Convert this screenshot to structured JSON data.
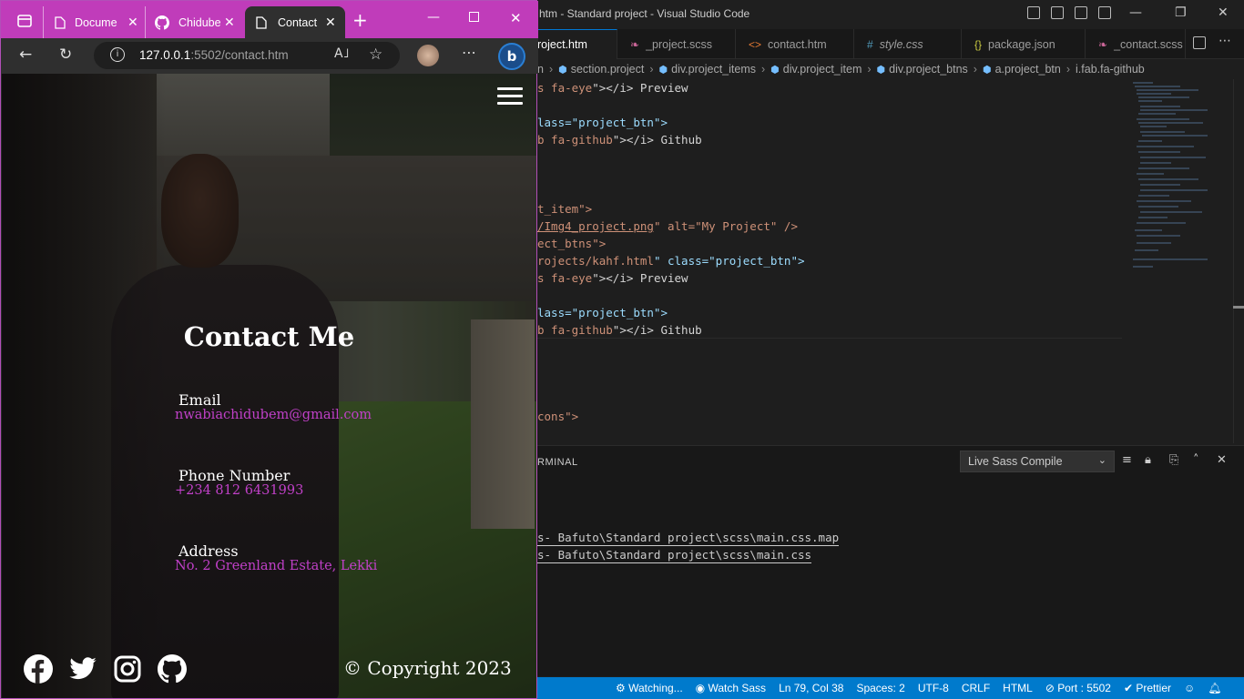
{
  "vscode": {
    "window_title": "htm - Standard project - Visual Studio Code",
    "tabs": [
      {
        "label": "roject.htm",
        "icon": "html-file-icon"
      },
      {
        "label": "_project.scss",
        "icon": "sass-file-icon"
      },
      {
        "label": "contact.htm",
        "icon": "html-file-icon"
      },
      {
        "label": "style.css",
        "icon": "css-file-icon"
      },
      {
        "label": "package.json",
        "icon": "json-file-icon"
      },
      {
        "label": "_contact.scss",
        "icon": "sass-file-icon"
      }
    ],
    "breadcrumb": [
      "n",
      "section.project",
      "div.project_items",
      "div.project_item",
      "div.project_btns",
      "a.project_btn",
      "i.fab.fa-github"
    ],
    "code_lines": [
      {
        "a": "s fa-eye",
        "b": "\"></i> Preview"
      },
      {
        "a": "lass=\"project_btn\">",
        "b": ""
      },
      {
        "a": "b fa-github",
        "b": "\"></i> Github"
      },
      {
        "a": "t_item\">",
        "b": ""
      },
      {
        "a": "/Img4_project.png",
        "b": "\" alt=\"My Project\" />"
      },
      {
        "a": "ect_btns\">",
        "b": ""
      },
      {
        "a": "rojects/kahf.html",
        "b": "\" class=\"project_btn\">"
      },
      {
        "a": "s fa-eye",
        "b": "\"></i> Preview"
      },
      {
        "a": "lass=\"project_btn\">",
        "b": ""
      },
      {
        "a": "b fa-github",
        "b": "\"></i> Github"
      },
      {
        "a": "cons\">",
        "b": ""
      }
    ],
    "panel": {
      "tab_label": "RMINAL",
      "dropdown_value": "Live Sass Compile",
      "terminal_lines": [
        "s- Bafuto\\Standard project\\scss\\main.css.map",
        "s- Bafuto\\Standard project\\scss\\main.css"
      ]
    },
    "statusbar": {
      "watching": "Watching...",
      "watch_sass": "Watch Sass",
      "position": "Ln 79, Col 38",
      "spaces": "Spaces: 2",
      "encoding": "UTF-8",
      "eol": "CRLF",
      "language": "HTML",
      "port": "Port : 5502",
      "prettier": "Prettier"
    },
    "colors": {
      "statusbar": "#007acc",
      "editor_bg": "#1e1e1e"
    }
  },
  "browser": {
    "tabs": [
      {
        "label": "Docume",
        "icon": "document-icon"
      },
      {
        "label": "Chidube",
        "icon": "github-icon"
      },
      {
        "label": "Contact",
        "icon": "document-icon",
        "active": true
      }
    ],
    "url_host": "127.0.0.1",
    "url_rest": ":5502/contact.htm",
    "colors": {
      "accent": "#c03cba"
    }
  },
  "page": {
    "title": "Contact Me",
    "email_label": "Email",
    "email_value": "nwabiachidubem@gmail.com",
    "phone_label": "Phone Number",
    "phone_value": "+234 812 6431993",
    "address_label": "Address",
    "address_value": "No. 2 Greenland Estate, Lekki",
    "copyright": "© Copyright 2023",
    "social": [
      "facebook-icon",
      "twitter-icon",
      "instagram-icon",
      "github-icon"
    ],
    "colors": {
      "link": "#c040c8"
    }
  }
}
